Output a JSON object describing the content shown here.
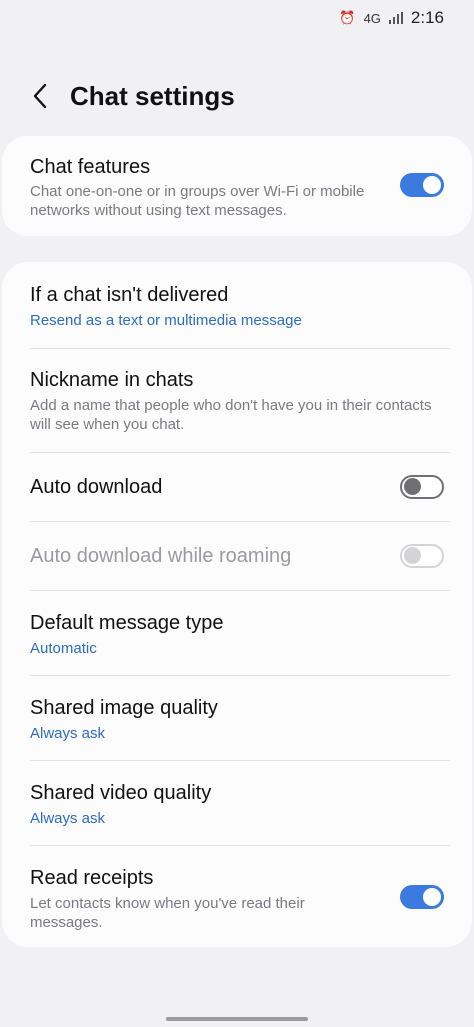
{
  "status_bar": {
    "time": "2:16",
    "network": "4G"
  },
  "header": {
    "title": "Chat settings"
  },
  "chat_features": {
    "label": "Chat features",
    "description": "Chat one-on-one or in groups over Wi-Fi or mobile networks without using text messages.",
    "enabled": true
  },
  "settings": {
    "undelivered": {
      "label": "If a chat isn't delivered",
      "value": "Resend as a text or multimedia message"
    },
    "nickname": {
      "label": "Nickname in chats",
      "description": "Add a name that people who don't have you in their contacts will see when you chat."
    },
    "auto_download": {
      "label": "Auto download",
      "enabled": false
    },
    "auto_download_roaming": {
      "label": "Auto download while roaming",
      "enabled": false,
      "disabled": true
    },
    "default_message_type": {
      "label": "Default message type",
      "value": "Automatic"
    },
    "shared_image_quality": {
      "label": "Shared image quality",
      "value": "Always ask"
    },
    "shared_video_quality": {
      "label": "Shared video quality",
      "value": "Always ask"
    },
    "read_receipts": {
      "label": "Read receipts",
      "description": "Let contacts know when you've read their messages.",
      "enabled": true
    }
  },
  "colors": {
    "accent": "#3b7be0",
    "link": "#2d6cc0",
    "background": "#f1f1f4",
    "card": "#fcfcfd"
  }
}
